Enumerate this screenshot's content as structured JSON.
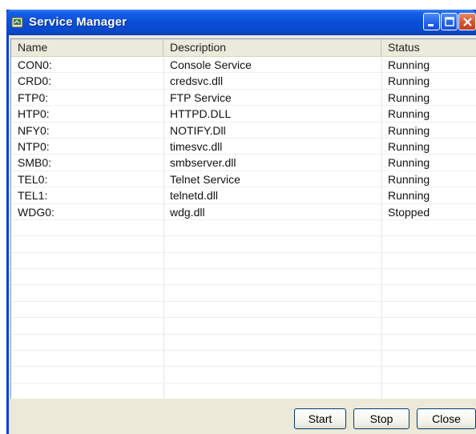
{
  "window": {
    "title": "Service Manager",
    "icons": [
      "app-icon",
      "minimize-icon",
      "maximize-icon",
      "close-icon"
    ]
  },
  "table": {
    "columns": [
      "Name",
      "Description",
      "Status"
    ],
    "rows": [
      {
        "name": "CON0:",
        "description": "Console Service",
        "status": "Running"
      },
      {
        "name": "CRD0:",
        "description": "credsvc.dll",
        "status": "Running"
      },
      {
        "name": "FTP0:",
        "description": "FTP Service",
        "status": "Running"
      },
      {
        "name": "HTP0:",
        "description": "HTTPD.DLL",
        "status": "Running"
      },
      {
        "name": "NFY0:",
        "description": "NOTIFY.Dll",
        "status": "Running"
      },
      {
        "name": "NTP0:",
        "description": "timesvc.dll",
        "status": "Running"
      },
      {
        "name": "SMB0:",
        "description": "smbserver.dll",
        "status": "Running"
      },
      {
        "name": "TEL0:",
        "description": "Telnet Service",
        "status": "Running"
      },
      {
        "name": "TEL1:",
        "description": "telnetd.dll",
        "status": "Running"
      },
      {
        "name": "WDG0:",
        "description": "wdg.dll",
        "status": "Stopped"
      }
    ]
  },
  "buttons": {
    "start": "Start",
    "stop": "Stop",
    "close": "Close"
  }
}
